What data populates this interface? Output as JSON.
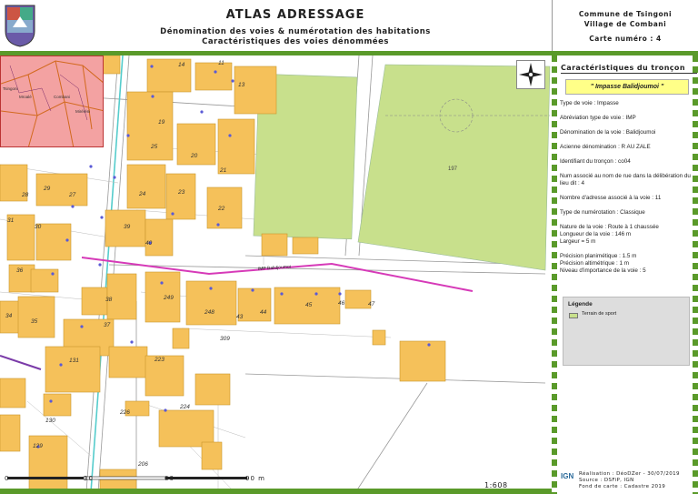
{
  "header": {
    "title": "ATLAS ADRESSAGE",
    "subtitle_line1": "Dénomination des voies & numérotation des habitations",
    "subtitle_line2": "Caractéristiques des voies dénommées",
    "commune": "Commune de Tsingoni",
    "village": "Village de Combani",
    "carte": "Carte numéro : 4"
  },
  "panel": {
    "title": "Caractéristiques du tronçon",
    "voie_name": "\" Impasse Balidjoumoi \"",
    "attributes": [
      "Type de voie : Impasse",
      "Abréviation type de voie : IMP",
      "Dénomination de la voie : Balidjoumoi",
      "Acienne dénomination : R AU ZALE",
      "Identifiant du tronçon : co04",
      "Num associé au nom de rue dans la délibération du lieu dit : 4",
      "Nombre d'adresse associé à la voie : 11",
      "Type de numérotation : Classique"
    ],
    "attributes_group1": [
      "Nature de la voie : Route à 1 chaussée",
      "Longueur de la voie : 146 m",
      "Largeur = 5 m"
    ],
    "attributes_group2": [
      "Précision planimétique : 1.5 m",
      "Précision altimétrique : 1 m",
      "Niveau d'importance de la voie : 5"
    ]
  },
  "legend": {
    "title": "Légende",
    "items": [
      {
        "label": "Terrain de sport",
        "color": "#c8e08c"
      }
    ]
  },
  "credits": {
    "line1": "Réalisation : DéoDZer - 30/07/2019",
    "line2": "Source : DSFiP, IGN",
    "line3": "Fond de carte : Cadastre 2019",
    "logo": "IGN"
  },
  "scale": {
    "ticks": [
      "0",
      "30",
      "60",
      "90 m"
    ],
    "ratio": "1:608"
  },
  "map": {
    "road_label": "IMP Balidjoumoi",
    "sport_label": "197",
    "inset_labels": [
      "Tsingoni",
      "Mroalé",
      "Combani",
      "Miréréni"
    ],
    "parcel_labels": [
      "14",
      "13",
      "11",
      "15",
      "19",
      "20",
      "21",
      "25",
      "24",
      "23",
      "22",
      "39",
      "40",
      "27",
      "28",
      "29",
      "30",
      "31",
      "36",
      "34",
      "35",
      "38",
      "37",
      "249",
      "248",
      "43",
      "44",
      "45",
      "46",
      "47",
      "309",
      "223",
      "224",
      "226",
      "131",
      "130",
      "129",
      "206",
      "207",
      "197"
    ],
    "colors": {
      "building": "#f5c15a",
      "sport": "#c8e08c",
      "road_highlight": "#d63ab8",
      "accent": "#5a9a2a"
    }
  }
}
